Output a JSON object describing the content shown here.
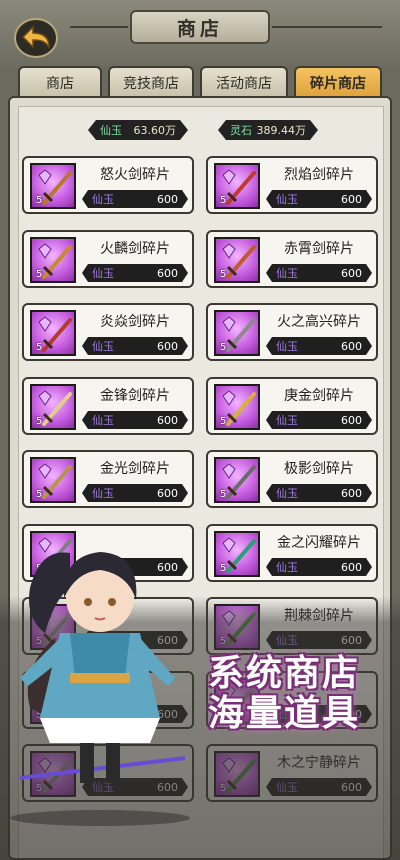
{
  "header": {
    "title": "商店"
  },
  "tabs": [
    {
      "label": "商店",
      "active": false
    },
    {
      "label": "竞技商店",
      "active": false
    },
    {
      "label": "活动商店",
      "active": false
    },
    {
      "label": "碎片商店",
      "active": true
    }
  ],
  "currencies": [
    {
      "name": "仙玉",
      "value": "63.60万"
    },
    {
      "name": "灵石",
      "value": "389.44万"
    }
  ],
  "items": [
    {
      "name": "怒火剑碎片",
      "count": "5",
      "currency": "仙玉",
      "price": "600",
      "blade": "#b9772a"
    },
    {
      "name": "烈焰剑碎片",
      "count": "5",
      "currency": "仙玉",
      "price": "600",
      "blade": "#c0392b"
    },
    {
      "name": "火麟剑碎片",
      "count": "5",
      "currency": "仙玉",
      "price": "600",
      "blade": "#c88a2c"
    },
    {
      "name": "赤霄剑碎片",
      "count": "5",
      "currency": "仙玉",
      "price": "600",
      "blade": "#c05a2a"
    },
    {
      "name": "炎焱剑碎片",
      "count": "5",
      "currency": "仙玉",
      "price": "600",
      "blade": "#b53a2a"
    },
    {
      "name": "火之高兴碎片",
      "count": "5",
      "currency": "仙玉",
      "price": "600",
      "blade": "#8a8a8a"
    },
    {
      "name": "金锋剑碎片",
      "count": "5",
      "currency": "仙玉",
      "price": "600",
      "blade": "#e1cf8a"
    },
    {
      "name": "庚金剑碎片",
      "count": "5",
      "currency": "仙玉",
      "price": "600",
      "blade": "#d7b23a"
    },
    {
      "name": "金光剑碎片",
      "count": "5",
      "currency": "仙玉",
      "price": "600",
      "blade": "#b8954a"
    },
    {
      "name": "极影剑碎片",
      "count": "5",
      "currency": "仙玉",
      "price": "600",
      "blade": "#6b6b6b"
    },
    {
      "name": "",
      "count": "5",
      "currency": "仙玉",
      "price": "600",
      "blade": "#7f7f7f"
    },
    {
      "name": "金之闪耀碎片",
      "count": "5",
      "currency": "仙玉",
      "price": "600",
      "blade": "#2aa07a"
    },
    {
      "name": "",
      "count": "5",
      "currency": "仙玉",
      "price": "600",
      "blade": "#8a8a8a"
    },
    {
      "name": "荆棘剑碎片",
      "count": "5",
      "currency": "仙玉",
      "price": "600",
      "blade": "#4a8a3a"
    },
    {
      "name": "",
      "count": "5",
      "currency": "仙玉",
      "price": "600",
      "blade": "#8a8a8a"
    },
    {
      "name": "",
      "count": "5",
      "currency": "仙玉",
      "price": "600",
      "blade": "#8a8a8a"
    },
    {
      "name": "",
      "count": "5",
      "currency": "仙玉",
      "price": "600",
      "blade": "#8a8a8a"
    },
    {
      "name": "木之宁静碎片",
      "count": "5",
      "currency": "仙玉",
      "price": "600",
      "blade": "#4a8a4a"
    }
  ],
  "promo": {
    "line1": "系统商店",
    "line2": "海量道具"
  }
}
